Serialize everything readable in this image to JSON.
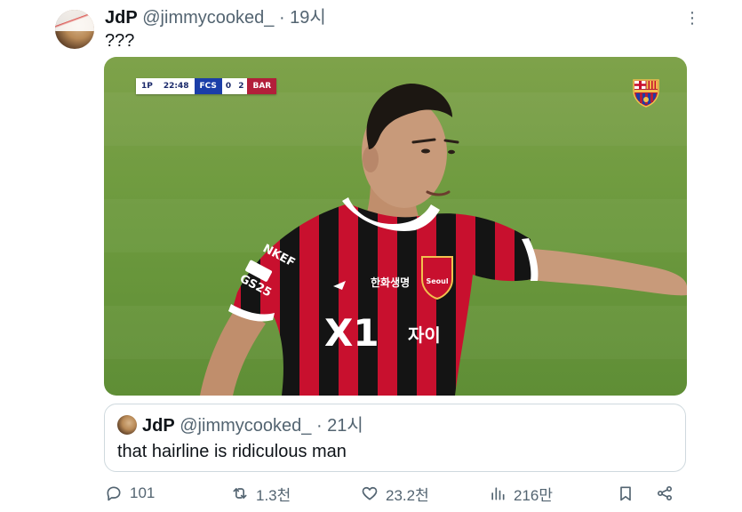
{
  "tweet": {
    "author_name": "JdP",
    "handle": "@jimmycooked_",
    "separator": "·",
    "time": "19시",
    "text": "???",
    "more_icon": "more-vertical-icon"
  },
  "media": {
    "scorebug": {
      "period": "1P",
      "clock": "22:48",
      "home": "FCS",
      "home_score": "0",
      "away_score": "2",
      "away": "BAR"
    },
    "jersey_sponsor": "X1",
    "jersey_sponsor_suffix": "자이",
    "club_badge_text": "Seoul",
    "chest_logo_text": "한화생명",
    "sleeve_text_top": "NKEF",
    "sleeve_text_bottom": "GS25",
    "colors": {
      "pitch": "#6d9a3e",
      "jersey_red": "#c8102e",
      "jersey_black": "#111111"
    }
  },
  "quote": {
    "author_name": "JdP",
    "handle": "@jimmycooked_",
    "separator": "·",
    "time": "21시",
    "text": "that hairline is ridiculous man"
  },
  "actions": {
    "replies": "101",
    "reposts": "1.3천",
    "likes": "23.2천",
    "views": "216만"
  }
}
